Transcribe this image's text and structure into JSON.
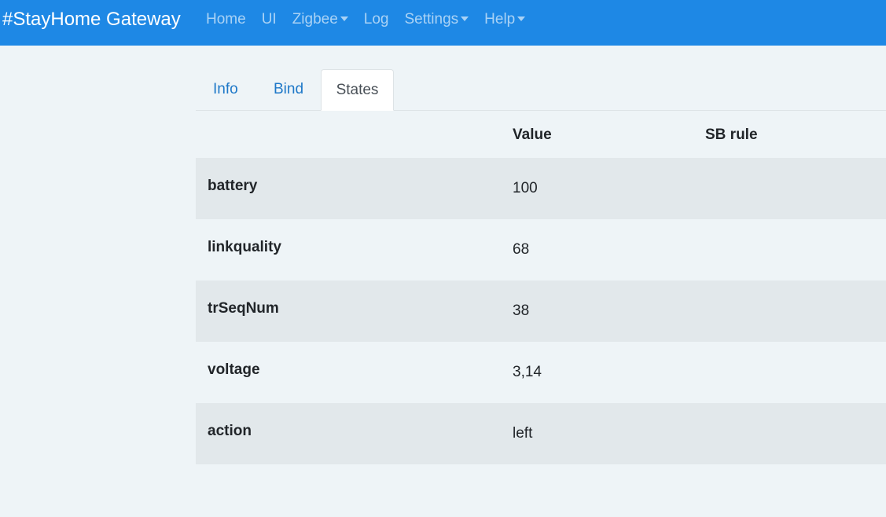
{
  "navbar": {
    "brand": "#StayHome Gateway",
    "links": [
      {
        "label": "Home"
      },
      {
        "label": "UI"
      },
      {
        "label": "Zigbee",
        "dropdown": true
      },
      {
        "label": "Log"
      },
      {
        "label": "Settings",
        "dropdown": true
      },
      {
        "label": "Help",
        "dropdown": true
      }
    ]
  },
  "tabs": {
    "info": "Info",
    "bind": "Bind",
    "states": "States",
    "active": "States"
  },
  "table": {
    "headers": [
      "",
      "Value",
      "SB rule"
    ],
    "rows": [
      {
        "name": "battery",
        "value": "100",
        "rule": ""
      },
      {
        "name": "linkquality",
        "value": "68",
        "rule": ""
      },
      {
        "name": "trSeqNum",
        "value": "38",
        "rule": ""
      },
      {
        "name": "voltage",
        "value": "3,14",
        "rule": ""
      },
      {
        "name": "action",
        "value": "left",
        "rule": ""
      }
    ]
  },
  "colors": {
    "navbar": "#1e88e5",
    "background": "#eef4f7",
    "stripe": "#e2e8eb",
    "tab_link": "#1e78c8"
  }
}
